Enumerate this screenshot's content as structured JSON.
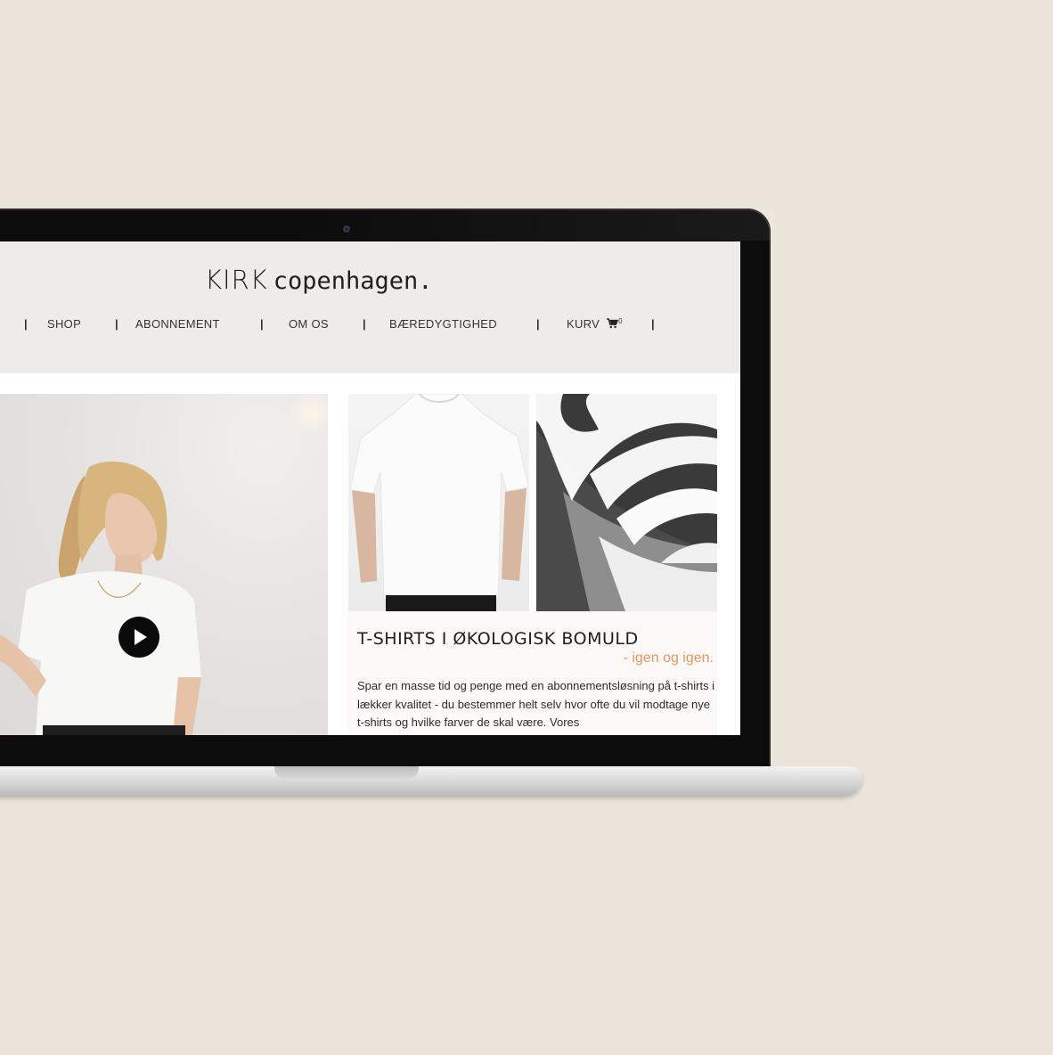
{
  "site": {
    "logo_brand": "KIRK",
    "logo_city": "copenhagen."
  },
  "nav": {
    "separator": "|",
    "shop": "SHOP",
    "abonnement": "ABONNEMENT",
    "om_os": "OM OS",
    "baeredygtighed": "BÆREDYGTIGHED",
    "kurv": "KURV",
    "cart_count": "0"
  },
  "hero": {
    "play_icon": "play-icon"
  },
  "product": {
    "title": "T-SHIRTS I ØKOLOGISK BOMULD",
    "subtitle": "- igen og igen.",
    "body": "Spar en masse tid og penge med en abonnementsløsning på t-shirts i lækker kvalitet - du bestemmer helt selv hvor ofte du vil modtage nye t-shirts og hvilke farver de skal være. Vores"
  },
  "colors": {
    "background": "#ebe4da",
    "header_bg": "#eeecea",
    "accent": "#e8965e",
    "text": "#1f1f1f"
  }
}
